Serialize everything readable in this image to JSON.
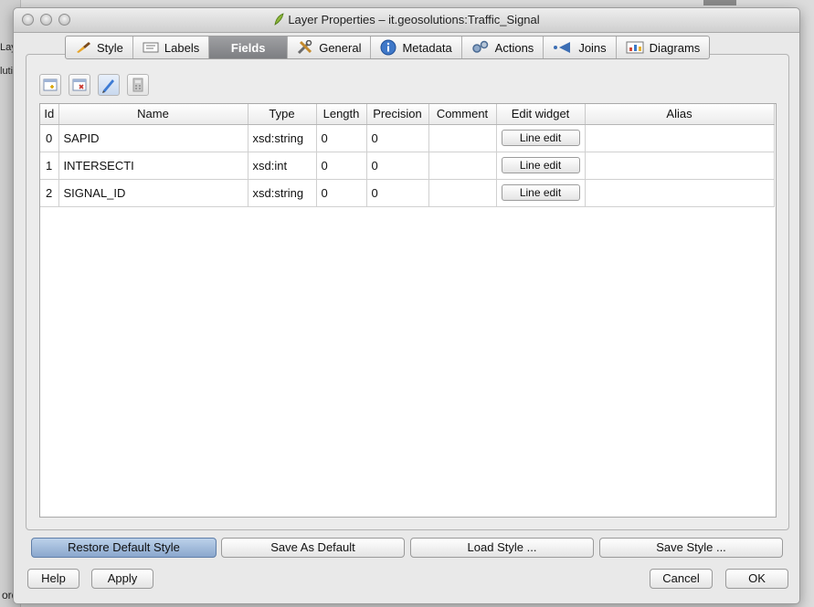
{
  "background": {
    "left_labels": [
      "Laye",
      "luti"
    ],
    "bottom_label": "order"
  },
  "window": {
    "title": "Layer Properties – it.geosolutions:Traffic_Signal"
  },
  "tabs": [
    {
      "label": "Style",
      "icon": "brush-icon"
    },
    {
      "label": "Labels",
      "icon": "labels-icon"
    },
    {
      "label": "Fields",
      "icon": "fields-icon",
      "active": true
    },
    {
      "label": "General",
      "icon": "tools-icon"
    },
    {
      "label": "Metadata",
      "icon": "info-icon"
    },
    {
      "label": "Actions",
      "icon": "gears-icon"
    },
    {
      "label": "Joins",
      "icon": "joins-icon"
    },
    {
      "label": "Diagrams",
      "icon": "diagram-icon"
    }
  ],
  "toolbar": {
    "buttons": [
      "new-column-icon",
      "delete-column-icon",
      "toggle-edit-icon",
      "calculator-icon"
    ]
  },
  "table": {
    "columns": [
      "Id",
      "Name",
      "Type",
      "Length",
      "Precision",
      "Comment",
      "Edit widget",
      "Alias"
    ],
    "rows": [
      {
        "id": "0",
        "name": "SAPID",
        "type": "xsd:string",
        "length": "0",
        "precision": "0",
        "comment": "",
        "widget": "Line edit",
        "alias": ""
      },
      {
        "id": "1",
        "name": "INTERSECTI",
        "type": "xsd:int",
        "length": "0",
        "precision": "0",
        "comment": "",
        "widget": "Line edit",
        "alias": ""
      },
      {
        "id": "2",
        "name": "SIGNAL_ID",
        "type": "xsd:string",
        "length": "0",
        "precision": "0",
        "comment": "",
        "widget": "Line edit",
        "alias": ""
      }
    ]
  },
  "style_buttons": {
    "restore": "Restore Default Style",
    "save_default": "Save As Default",
    "load": "Load Style ...",
    "save": "Save Style ..."
  },
  "dialog_buttons": {
    "help": "Help",
    "apply": "Apply",
    "cancel": "Cancel",
    "ok": "OK"
  }
}
